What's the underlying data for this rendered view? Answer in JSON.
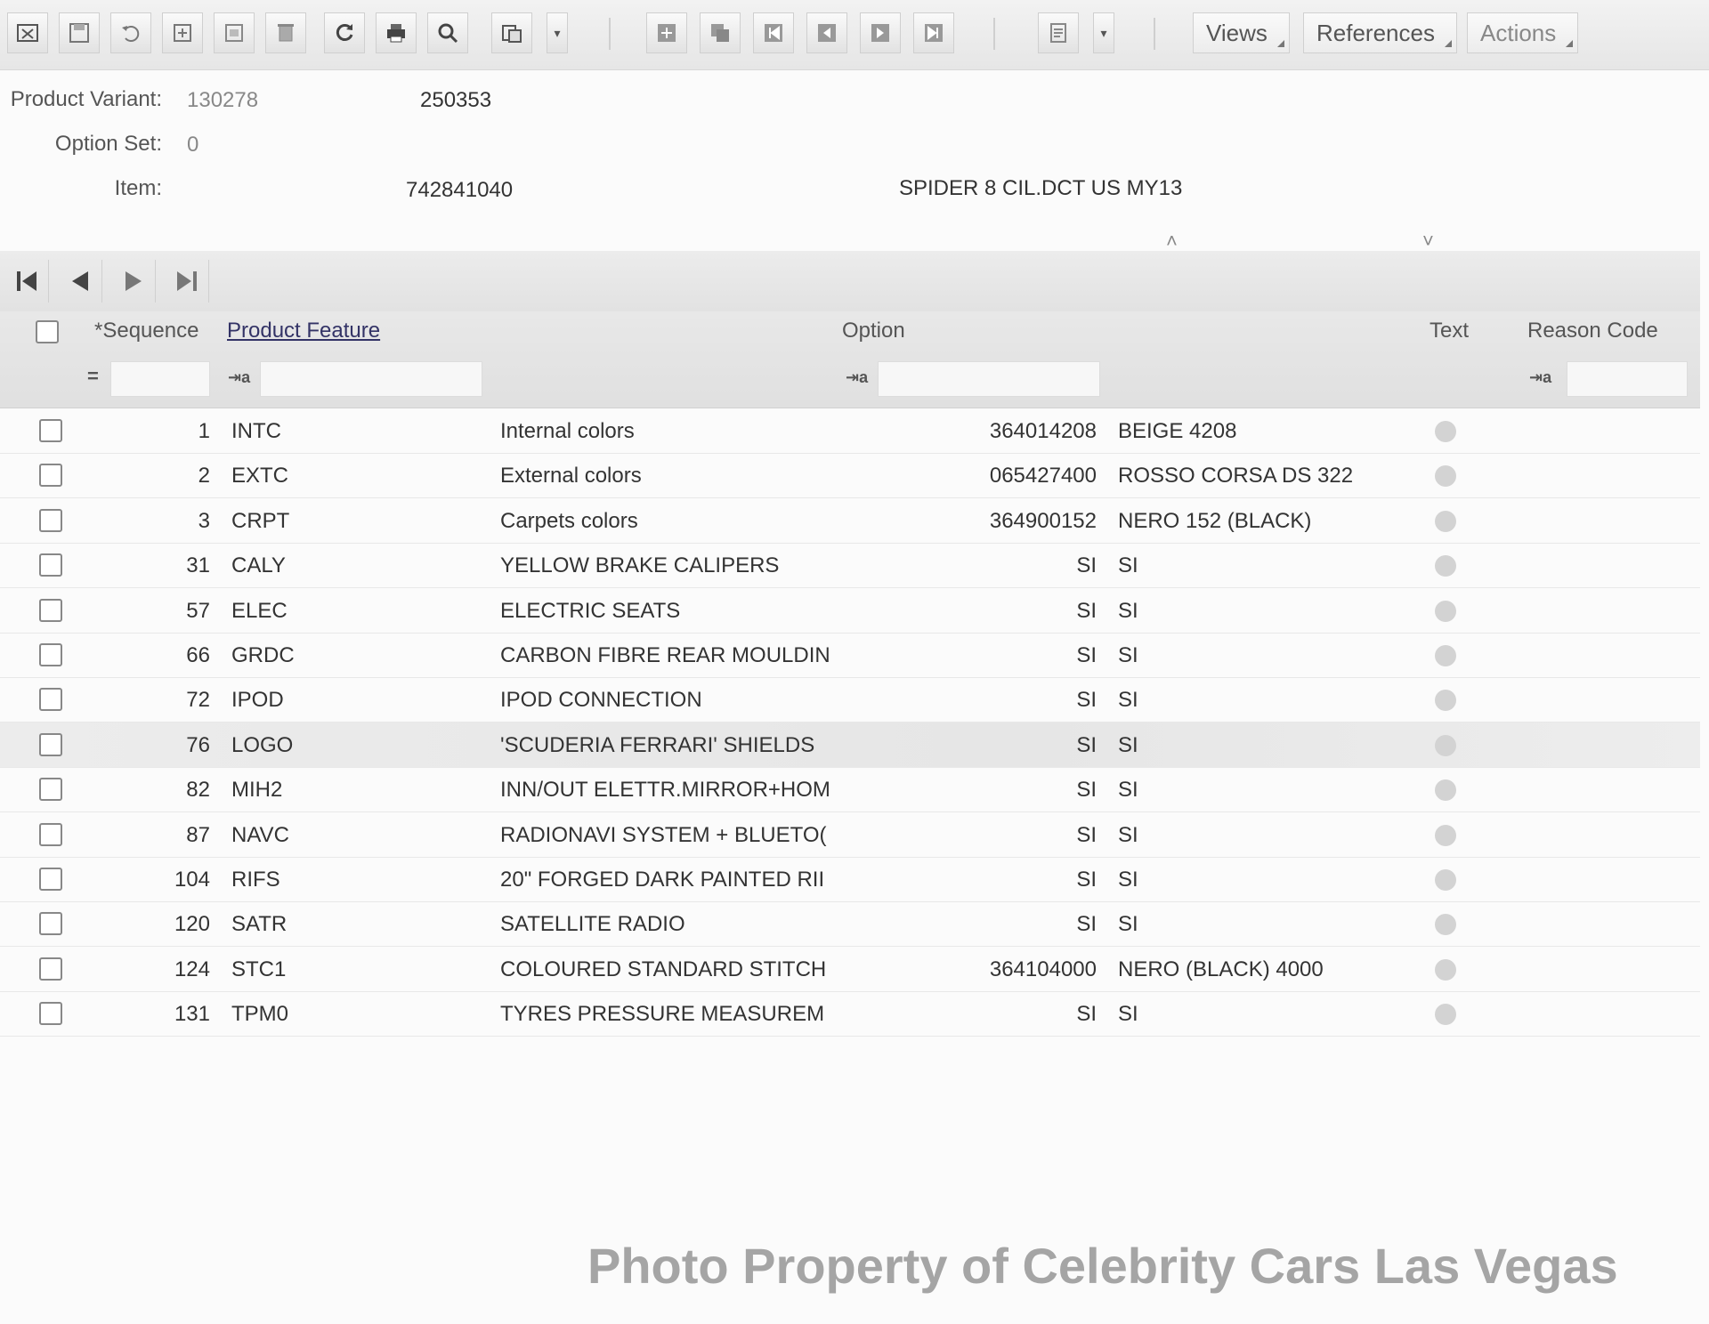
{
  "toolbar": {
    "views_label": "Views",
    "references_label": "References",
    "actions_label": "Actions"
  },
  "header": {
    "product_variant_label": "Product Variant:",
    "product_variant_value": "130278",
    "product_variant_code": "250353",
    "option_set_label": "Option Set:",
    "option_set_value": "0",
    "item_label": "Item:",
    "item_value": "742841040",
    "item_description": "SPIDER 8 CIL.DCT  US MY13"
  },
  "grid": {
    "columns": {
      "sequence": "*Sequence",
      "product_feature": "Product Feature",
      "option": "Option",
      "text": "Text",
      "reason_code": "Reason Code"
    },
    "rows": [
      {
        "seq": "1",
        "code": "INTC",
        "feature": "Internal colors",
        "opt_code": "364014208",
        "opt_desc": "BEIGE 4208"
      },
      {
        "seq": "2",
        "code": "EXTC",
        "feature": "External colors",
        "opt_code": "065427400",
        "opt_desc": "ROSSO CORSA DS 322"
      },
      {
        "seq": "3",
        "code": "CRPT",
        "feature": "Carpets colors",
        "opt_code": "364900152",
        "opt_desc": "NERO 152 (BLACK)"
      },
      {
        "seq": "31",
        "code": "CALY",
        "feature": "YELLOW BRAKE CALIPERS",
        "opt_code": "SI",
        "opt_desc": "SI"
      },
      {
        "seq": "57",
        "code": "ELEC",
        "feature": "ELECTRIC SEATS",
        "opt_code": "SI",
        "opt_desc": "SI"
      },
      {
        "seq": "66",
        "code": "GRDC",
        "feature": "CARBON FIBRE REAR MOULDIN",
        "opt_code": "SI",
        "opt_desc": "SI"
      },
      {
        "seq": "72",
        "code": "IPOD",
        "feature": "IPOD CONNECTION",
        "opt_code": "SI",
        "opt_desc": "SI"
      },
      {
        "seq": "76",
        "code": "LOGO",
        "feature": "'SCUDERIA FERRARI' SHIELDS",
        "opt_code": "SI",
        "opt_desc": "SI"
      },
      {
        "seq": "82",
        "code": "MIH2",
        "feature": "INN/OUT ELETTR.MIRROR+HOM",
        "opt_code": "SI",
        "opt_desc": "SI"
      },
      {
        "seq": "87",
        "code": "NAVC",
        "feature": "RADIONAVI SYSTEM + BLUETO(",
        "opt_code": "SI",
        "opt_desc": "SI"
      },
      {
        "seq": "104",
        "code": "RIFS",
        "feature": "20\" FORGED DARK PAINTED RII",
        "opt_code": "SI",
        "opt_desc": "SI"
      },
      {
        "seq": "120",
        "code": "SATR",
        "feature": "SATELLITE RADIO",
        "opt_code": "SI",
        "opt_desc": "SI"
      },
      {
        "seq": "124",
        "code": "STC1",
        "feature": "COLOURED STANDARD STITCH",
        "opt_code": "364104000",
        "opt_desc": "NERO (BLACK) 4000"
      },
      {
        "seq": "131",
        "code": "TPM0",
        "feature": "TYRES PRESSURE MEASUREM",
        "opt_code": "SI",
        "opt_desc": "SI"
      }
    ]
  },
  "watermark": "Photo Property of Celebrity Cars Las Vegas"
}
